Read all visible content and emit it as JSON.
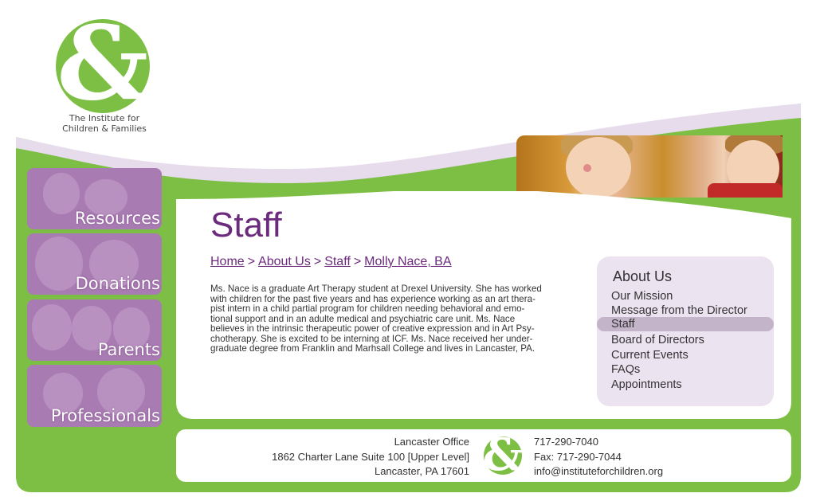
{
  "brand": {
    "logo_symbol": "&",
    "name_line1": "The Institute for",
    "name_line2": "Children & Families"
  },
  "colors": {
    "brand_green": "#7dbf45",
    "brand_purple": "#6b2a7c",
    "nav_purple": "#a97bb3",
    "menu_bg": "#ece3f0",
    "menu_active": "#c4b4c9"
  },
  "header_photo": "children-in-autumn-leaves-photo",
  "left_nav": {
    "items": [
      {
        "label": "Resources"
      },
      {
        "label": "Donations"
      },
      {
        "label": "Parents"
      },
      {
        "label": "Professionals"
      }
    ]
  },
  "main": {
    "title": "Staff",
    "breadcrumb": [
      {
        "label": "Home"
      },
      {
        "label": "About Us"
      },
      {
        "label": "Staff"
      },
      {
        "label": "Molly Nace, BA"
      }
    ],
    "breadcrumb_separator": ">",
    "bio_lines": [
      "Ms. Nace is a graduate Art Therapy student at Drexel University. She has worked",
      "with children for the past five years and has experience working as an art thera-",
      "pist intern in a child partial program for children needing behavioral and emo-",
      "tional support and in an adulte medical and psychiatric care unit. Ms. Nace",
      "believes in the intrinsic therapeutic power of creative expression and in Art Psy-",
      "chotherapy. She is excited to be interning at ICF. Ms. Nace received her under-",
      "graduate degree from Franklin and Marhsall College and lives in Lancaster, PA."
    ]
  },
  "side_menu": {
    "title": "About Us",
    "items": [
      {
        "label": "Our Mission"
      },
      {
        "label": "Message from the Director"
      },
      {
        "label": "Staff"
      },
      {
        "label": "Board of Directors"
      },
      {
        "label": "Current Events"
      },
      {
        "label": "FAQs"
      },
      {
        "label": "Appointments"
      }
    ],
    "active_item": "Staff"
  },
  "footer": {
    "office_name": "Lancaster Office",
    "street": "1862 Charter Lane Suite 100 [Upper Level]",
    "city": "Lancaster, PA 17601",
    "phone": "717-290-7040",
    "fax": "Fax: 717-290-7044",
    "email": "info@instituteforchildren.org",
    "logo_symbol": "&"
  }
}
